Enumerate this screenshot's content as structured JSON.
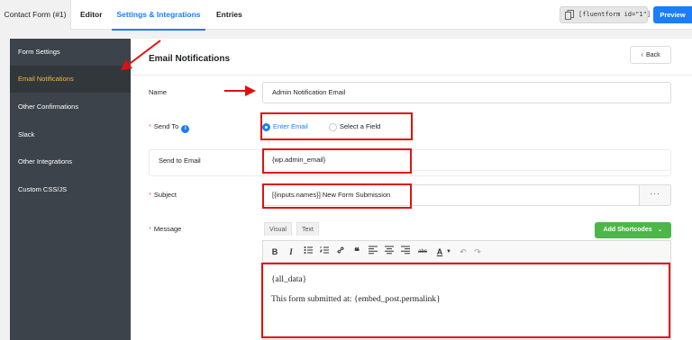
{
  "topbar": {
    "tabs": [
      "Contact Form (#1)",
      "Editor",
      "Settings & Integrations",
      "Entries"
    ],
    "shortcode": "[fluentform id=\"1\"]",
    "preview_label": "Preview"
  },
  "sidebar": {
    "items": [
      {
        "label": "Form Settings"
      },
      {
        "label": "Email Notifications"
      },
      {
        "label": "Other Confirmations"
      },
      {
        "label": "Slack"
      },
      {
        "label": "Other Integrations"
      },
      {
        "label": "Custom CSS/JS"
      }
    ]
  },
  "panel": {
    "title": "Email Notifications",
    "back_label": "Back",
    "name": {
      "label": "Name",
      "value": "Admin Notification Email"
    },
    "send_to": {
      "label": "Send To",
      "options": [
        "Enter Email",
        "Select a Field"
      ],
      "selected": "Enter Email"
    },
    "send_to_email": {
      "label": "Send to Email",
      "value": "{wp.admin_email}"
    },
    "subject": {
      "label": "Subject",
      "value": "[{inputs.names}] New Form Submission",
      "more_label": "···"
    },
    "message": {
      "label": "Message",
      "editor_tabs": [
        "Visual",
        "Text"
      ],
      "add_shortcodes_label": "Add Shortcodes",
      "toolbar": [
        "B",
        "I",
        "bullet-list",
        "numbered-list",
        "link",
        "quote",
        "align-left",
        "align-center",
        "align-right",
        "abc",
        "A",
        "undo",
        "redo"
      ],
      "body_lines": [
        "{all_data}",
        "This form submitted at: {embed_post.permalink}"
      ]
    }
  },
  "colors": {
    "accent": "#1a7efb",
    "active_menu": "#f0b849",
    "annotation": "#e11010",
    "green": "#4cb648"
  }
}
